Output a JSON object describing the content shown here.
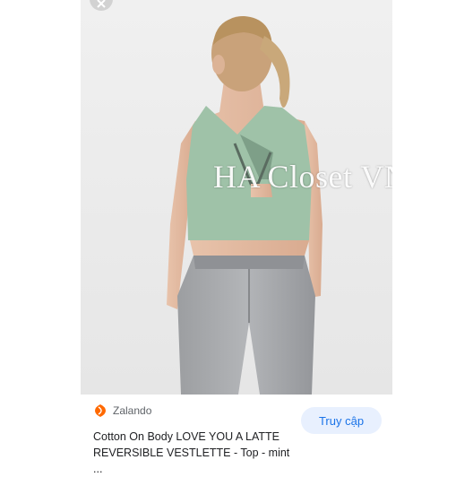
{
  "watermark": {
    "text": "HA Closet VNXK"
  },
  "source": {
    "name": "Zalando",
    "logo_icon": "zalando-logo-icon",
    "logo_color": "#ff6900"
  },
  "product": {
    "title": "Cotton On Body LOVE YOU A LATTE REVERSIBLE VESTLETTE - Top - mint ..."
  },
  "visit_button": {
    "label": "Truy cập"
  },
  "close_button": {
    "icon": "close-icon"
  },
  "colors": {
    "accent": "#1a73e8",
    "button_bg": "#e8f0fe",
    "top_mint": "#9fc2a8",
    "pants_gray": "#a4a6a9"
  }
}
